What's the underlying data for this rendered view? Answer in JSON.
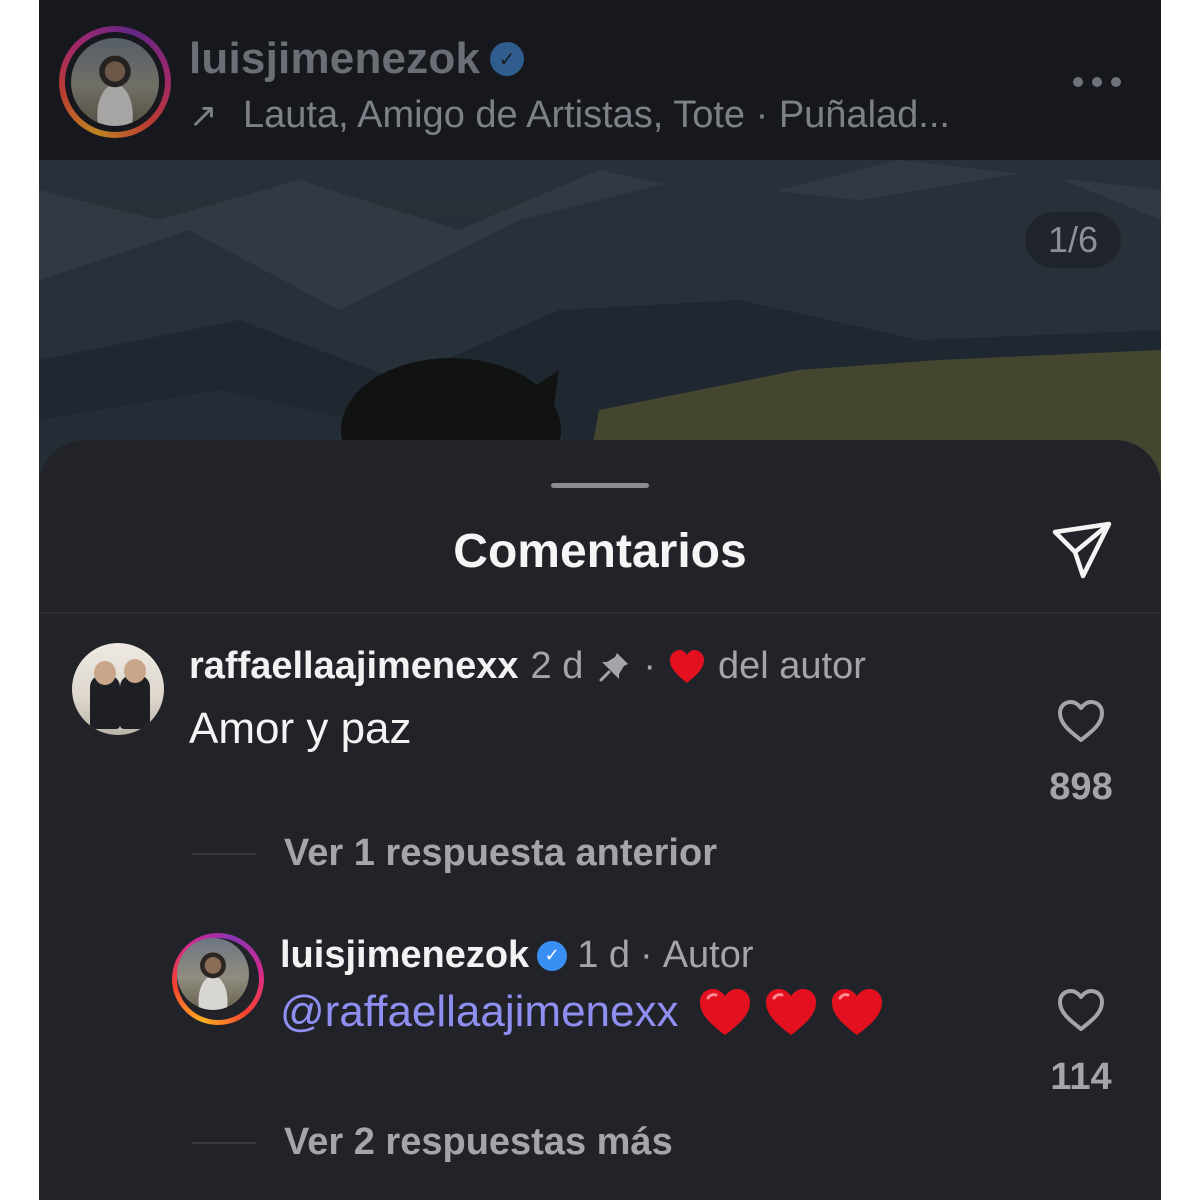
{
  "post": {
    "username": "luisjimenezok",
    "music_arrow": "↗",
    "music_text": "Lauta, Amigo de Artistas, Tote · Puñalad...",
    "page_counter": "1/6"
  },
  "sheet": {
    "title": "Comentarios"
  },
  "comments": [
    {
      "username": "raffaellaajimenexx",
      "time": "2 d",
      "separator": "·",
      "author_like_label": "del autor",
      "text": "Amor y paz",
      "likes": "898",
      "view_replies": "Ver 1 respuesta anterior"
    },
    {
      "username": "luisjimenezok",
      "time": "1 d",
      "separator": "·",
      "role": "Autor",
      "mention": "@raffaellaajimenexx",
      "likes": "114",
      "view_replies": "Ver 2 respuestas más"
    }
  ],
  "colors": {
    "background": "#222328",
    "mention": "#8f8ff2",
    "verified": "#3a8ff5",
    "heart": "#e3111f"
  }
}
